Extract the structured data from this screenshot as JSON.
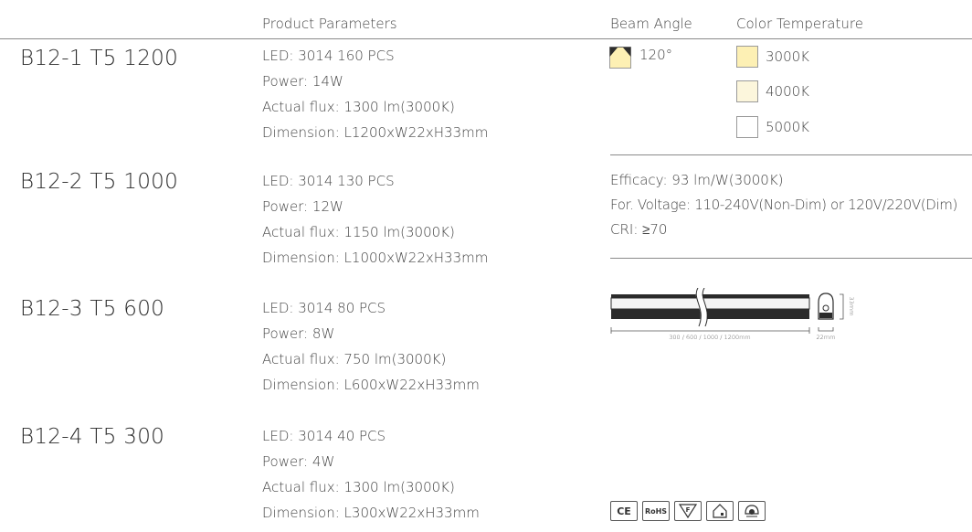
{
  "header": {
    "product_parameters": "Product Parameters",
    "beam_angle": "Beam Angle",
    "color_temperature": "Color Temperature"
  },
  "models": [
    {
      "name": "B12-1 T5 1200",
      "specs": [
        "LED: 3014 160 PCS",
        "Power: 14W",
        "Actual flux: 1300 lm(3000K)",
        "Dimension: L1200xW22xH33mm"
      ]
    },
    {
      "name": "B12-2 T5 1000",
      "specs": [
        "LED: 3014 130 PCS",
        "Power: 12W",
        "Actual flux: 1150 lm(3000K)",
        "Dimension: L1000xW22xH33mm"
      ]
    },
    {
      "name": "B12-3 T5 600",
      "specs": [
        "LED: 3014 80 PCS",
        "Power: 8W",
        "Actual flux: 750 lm(3000K)",
        "Dimension: L600xW22xH33mm"
      ]
    },
    {
      "name": "B12-4 T5 300",
      "specs": [
        "LED: 3014 40 PCS",
        "Power: 4W",
        "Actual flux: 1300 lm(3000K)",
        "Dimension: L300xW22xH33mm"
      ]
    }
  ],
  "beam": {
    "angle": "120°",
    "icon": "beam-angle-icon",
    "color": "#fdf0b4"
  },
  "color_temps": [
    {
      "label": "3000K",
      "color": "#fdf0b4"
    },
    {
      "label": "4000K",
      "color": "#fcf6dc"
    },
    {
      "label": "5000K",
      "color": "#ffffff"
    }
  ],
  "info": {
    "efficacy": "Efficacy: 93 lm/W(3000K)",
    "voltage": "For. Voltage: 110-240V(Non-Dim) or 120V/220V(Dim)",
    "cri": "CRI: ≥70"
  },
  "diagram": {
    "length_label": "300 / 600 / 1000 / 1200mm",
    "width_label": "22mm",
    "height_label": "33mm"
  },
  "certifications": [
    {
      "label": "CE",
      "icon": "ce-mark-icon"
    },
    {
      "label": "RoHS",
      "icon": "rohs-mark-icon"
    },
    {
      "label": "F",
      "icon": "f-mark-icon"
    },
    {
      "label": "",
      "icon": "indoor-use-icon"
    },
    {
      "label": "",
      "icon": "lamp-cap-icon"
    }
  ]
}
